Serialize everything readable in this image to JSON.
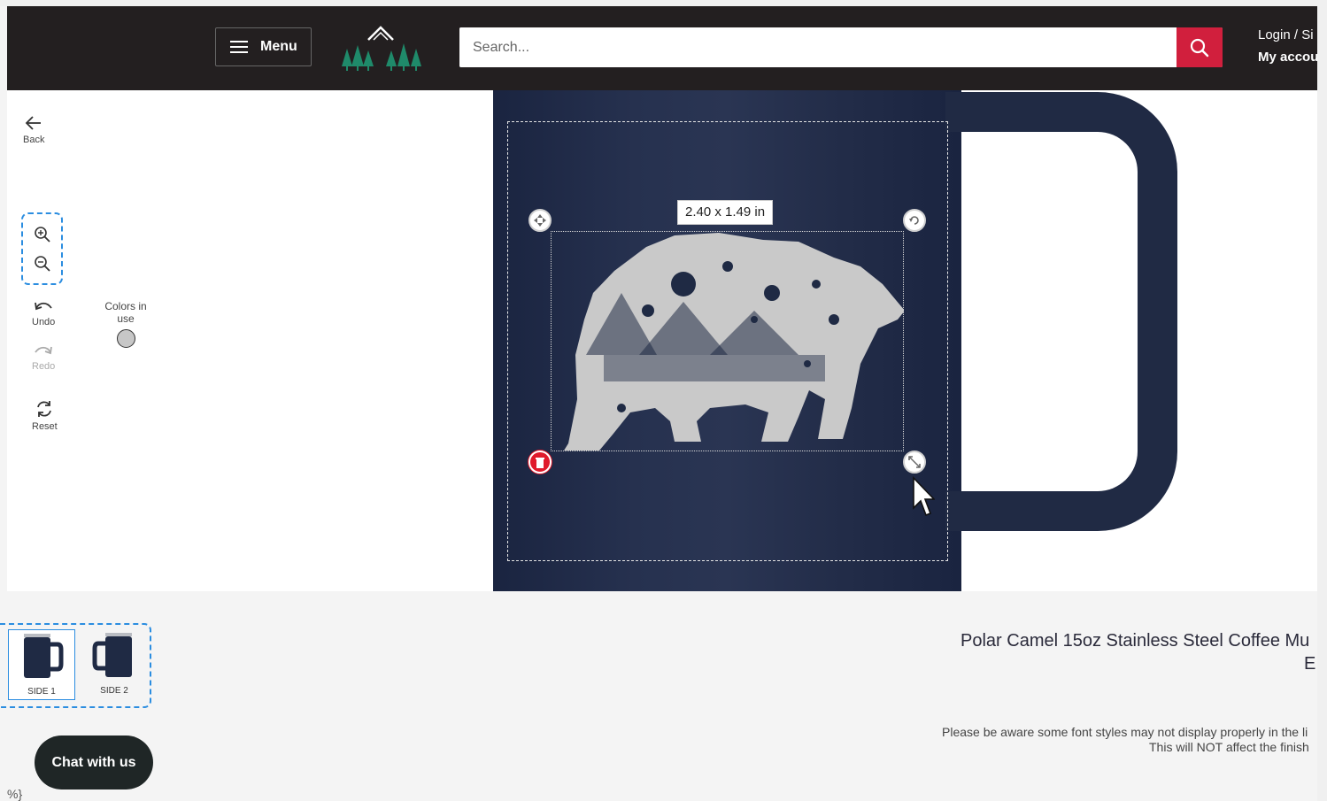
{
  "header": {
    "menu_label": "Menu",
    "search_placeholder": "Search...",
    "login_text": "Login / Si",
    "account_text": "My accou"
  },
  "tools": {
    "back": "Back",
    "undo": "Undo",
    "redo": "Redo",
    "reset": "Reset",
    "colors_in_use": "Colors in use",
    "swatch_color": "#c7c7c7"
  },
  "design": {
    "size_label": "2.40 x 1.49 in",
    "mug_color": "#1f2a44",
    "art_color": "#c9c9c9"
  },
  "sides": [
    {
      "label": "SIDE 1",
      "active": true
    },
    {
      "label": "SIDE 2",
      "active": false
    }
  ],
  "product": {
    "title_line1": "Polar Camel 15oz Stainless Steel Coffee Mu",
    "title_line2": "E",
    "notice_line1": "Please be aware some font styles may not display properly in the li",
    "notice_line2": "This will NOT affect the finish"
  },
  "chat": {
    "label": "Chat with us"
  },
  "stray_text": "%}",
  "colors": {
    "accent": "#d11f3d",
    "selection": "#2b8de0",
    "header_bg": "#231f20"
  }
}
